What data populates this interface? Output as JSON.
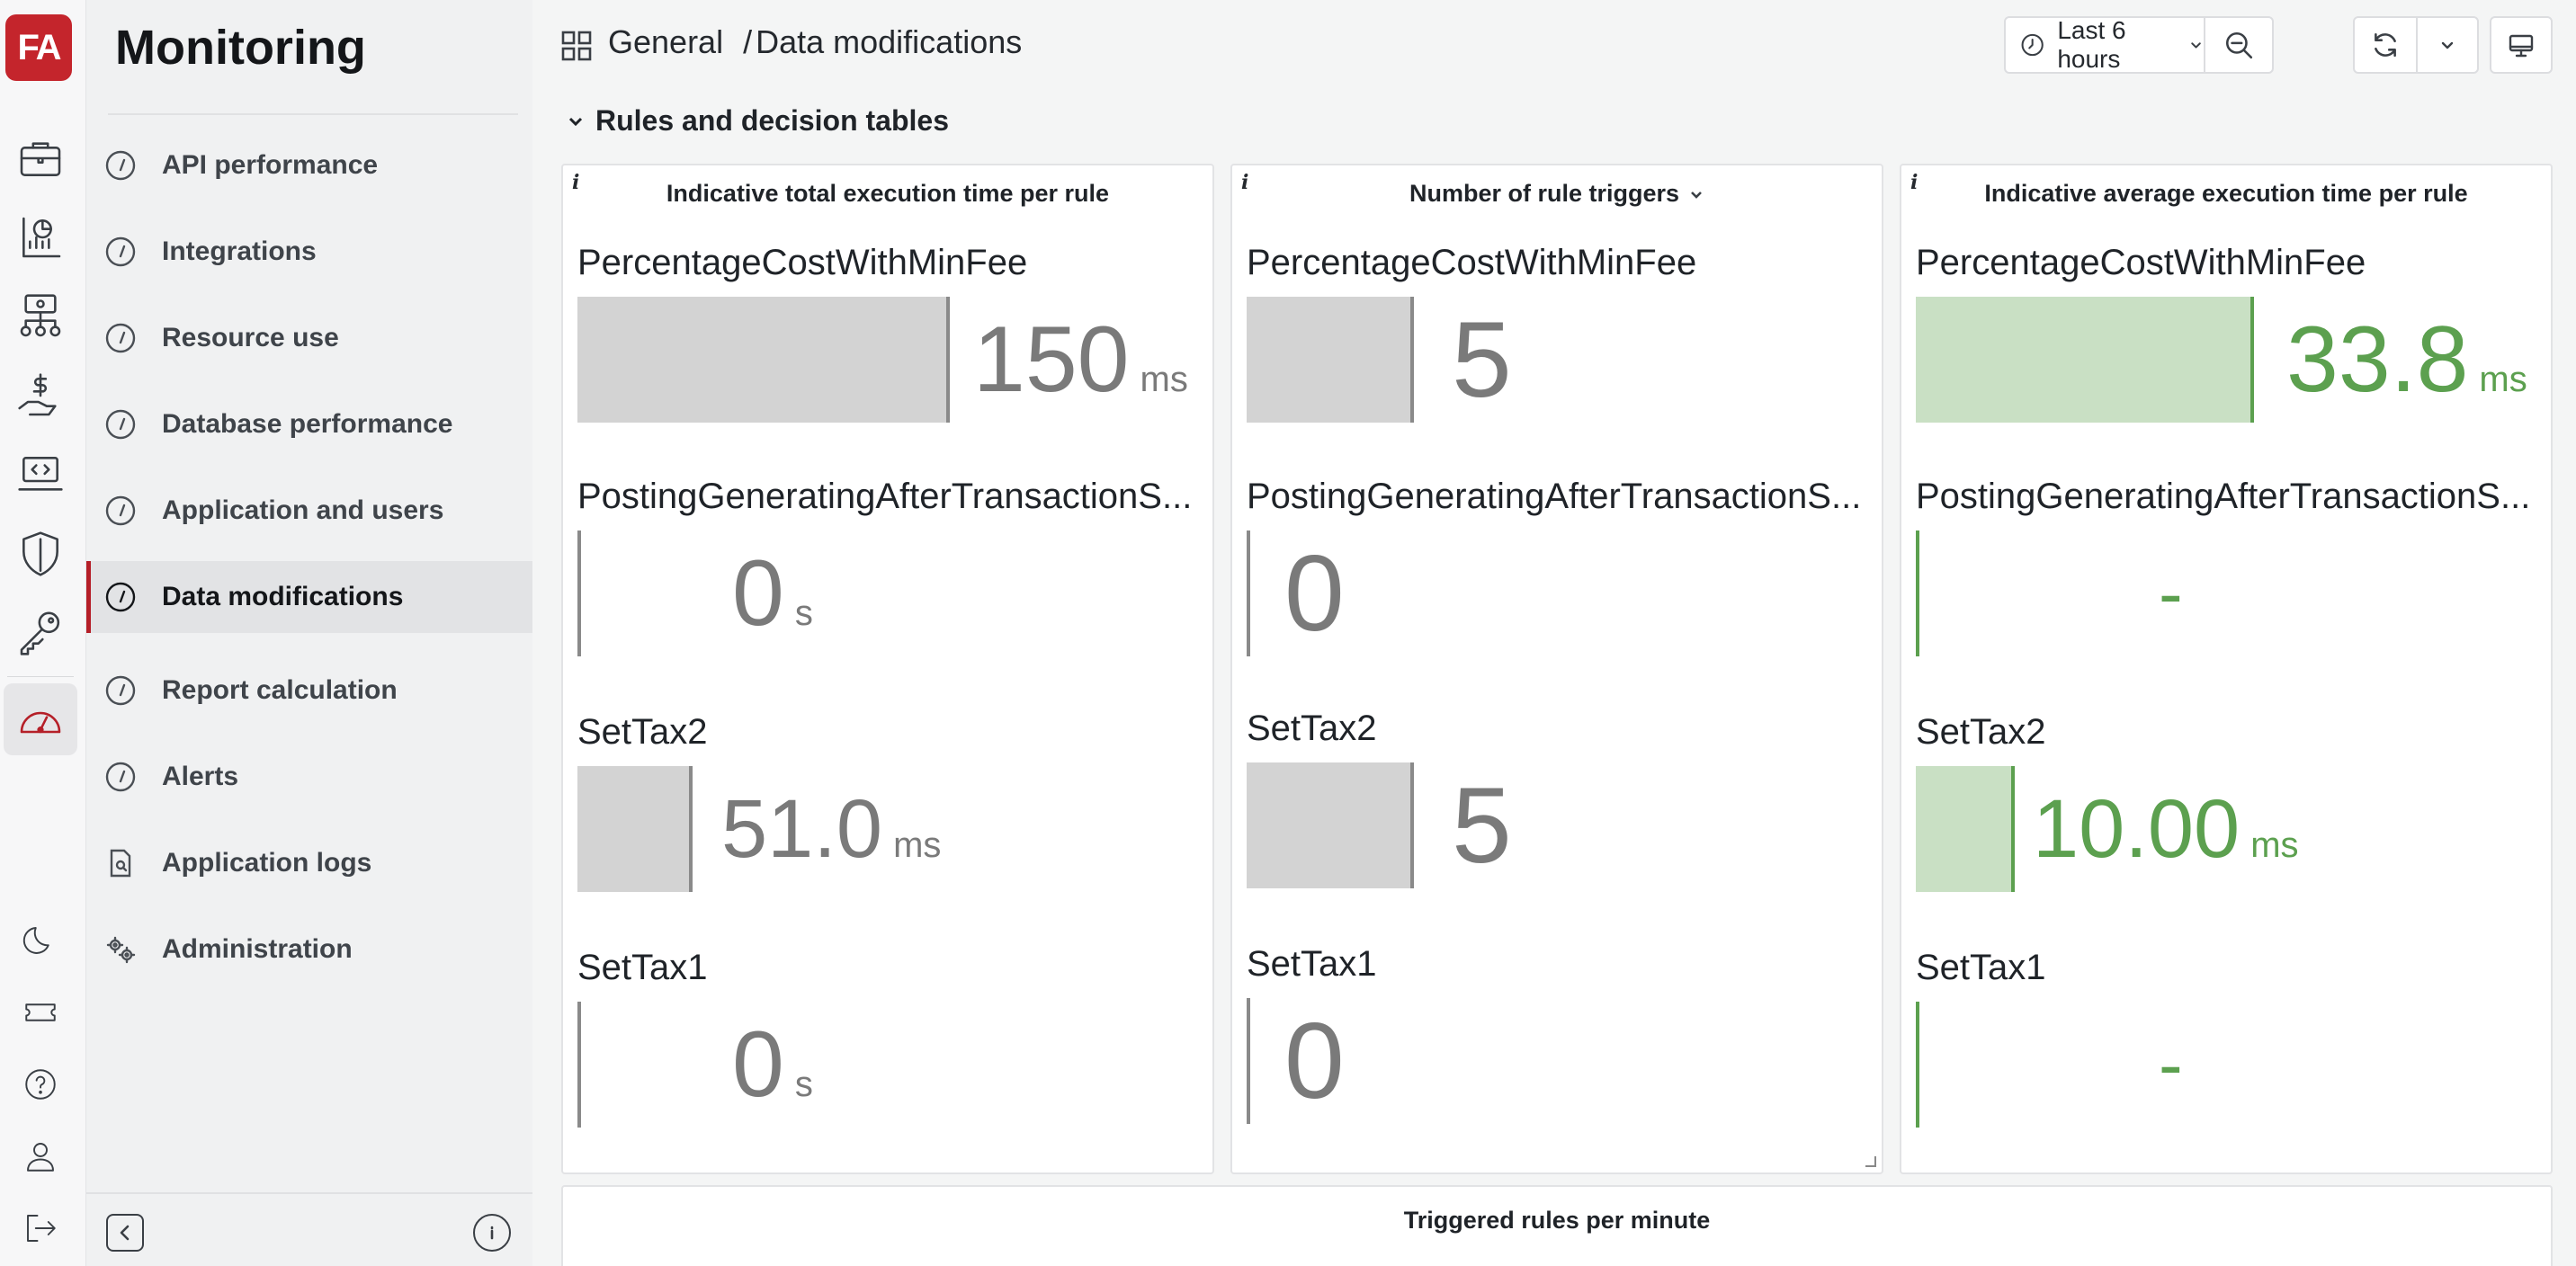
{
  "app": {
    "logo_text": "FA",
    "section_title": "Monitoring"
  },
  "nav": {
    "items": [
      {
        "label": "API performance",
        "icon": "gauge-icon"
      },
      {
        "label": "Integrations",
        "icon": "gauge-icon"
      },
      {
        "label": "Resource use",
        "icon": "gauge-icon"
      },
      {
        "label": "Database performance",
        "icon": "gauge-icon"
      },
      {
        "label": "Application and users",
        "icon": "gauge-icon"
      },
      {
        "label": "Data modifications",
        "icon": "gauge-icon",
        "active": true
      },
      {
        "label": "Report calculation",
        "icon": "gauge-icon"
      },
      {
        "label": "Alerts",
        "icon": "gauge-icon"
      },
      {
        "label": "Application logs",
        "icon": "log-search-icon"
      },
      {
        "label": "Administration",
        "icon": "gears-icon"
      }
    ]
  },
  "header": {
    "breadcrumb_root": "General",
    "breadcrumb_separator": "/",
    "breadcrumb_current": "Data modifications",
    "time_range": "Last 6 hours"
  },
  "row": {
    "title": "Rules and decision tables"
  },
  "panels": [
    {
      "info": "i",
      "title": "Indicative total execution time per rule",
      "stats": [
        {
          "name": "PercentageCostWithMinFee",
          "value": "150",
          "unit": "ms",
          "fill": 0.6
        },
        {
          "name": "PostingGeneratingAfterTransactionS...",
          "value": "0",
          "unit": "s",
          "fill": 0
        },
        {
          "name": "SetTax2",
          "value": "51.0",
          "unit": "ms",
          "fill": 0.18
        },
        {
          "name": "SetTax1",
          "value": "0",
          "unit": "s",
          "fill": 0
        }
      ]
    },
    {
      "info": "i",
      "title": "Number of rule triggers",
      "stats": [
        {
          "name": "PercentageCostWithMinFee",
          "value": "5",
          "unit": "",
          "fill": 0.27
        },
        {
          "name": "PostingGeneratingAfterTransactionS...",
          "value": "0",
          "unit": "",
          "fill": 0
        },
        {
          "name": "SetTax2",
          "value": "5",
          "unit": "",
          "fill": 0.27
        },
        {
          "name": "SetTax1",
          "value": "0",
          "unit": "",
          "fill": 0
        }
      ]
    },
    {
      "info": "i",
      "title": "Indicative average execution time per rule",
      "stats": [
        {
          "name": "PercentageCostWithMinFee",
          "value": "33.8",
          "unit": "ms",
          "fill": 0.55
        },
        {
          "name": "PostingGeneratingAfterTransactionS...",
          "value": "-",
          "unit": "",
          "fill": 0
        },
        {
          "name": "SetTax2",
          "value": "10.00",
          "unit": "ms",
          "fill": 0.16
        },
        {
          "name": "SetTax1",
          "value": "-",
          "unit": "",
          "fill": 0
        }
      ]
    }
  ],
  "bottom_panel": {
    "title": "Triggered rules per minute"
  },
  "colors": {
    "brand": "#c4252c",
    "accent_green": "#5ca04f",
    "bar_gray": "#d3d3d3"
  }
}
